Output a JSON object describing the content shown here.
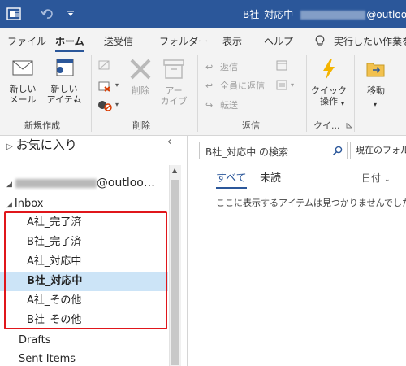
{
  "titlebar": {
    "app_icon": "outlook-app-icon",
    "undo_icon": "undo-icon",
    "qat_icon": "customize-quick-access-icon",
    "title_prefix": "B社_対応中 -",
    "title_suffix": "@outlook"
  },
  "tabs": [
    {
      "label": "ファイル"
    },
    {
      "label": "ホーム"
    },
    {
      "label": "送受信"
    },
    {
      "label": "フォルダー"
    },
    {
      "label": "表示"
    },
    {
      "label": "ヘルプ"
    },
    {
      "label": "実行したい作業を"
    }
  ],
  "ribbon": {
    "new_mail": "新しい\nメール",
    "new_items": "新しい\nアイテム",
    "delete": "削除",
    "archive": "アー\nカイブ",
    "reply": "返信",
    "reply_all": "全員に返信",
    "forward": "転送",
    "quick_steps": "クイック\n操作",
    "move": "移動",
    "groups": {
      "new": "新規作成",
      "delete": "削除",
      "respond": "返信",
      "quick": "クイ..."
    }
  },
  "leftpane": {
    "favorites": "お気に入り",
    "account_suffix": "@outloo…",
    "inbox": "Inbox",
    "folders": [
      {
        "label": "A社_完了済",
        "selected": false
      },
      {
        "label": "B社_完了済",
        "selected": false
      },
      {
        "label": "A社_対応中",
        "selected": false
      },
      {
        "label": "B社_対応中",
        "selected": true
      },
      {
        "label": "A社_その他",
        "selected": false
      },
      {
        "label": "B社_その他",
        "selected": false
      }
    ],
    "drafts": "Drafts",
    "sent": "Sent Items"
  },
  "rightpane": {
    "search_placeholder": "B社_対応中 の検索",
    "scope": "現在のフォルダー",
    "filter_all": "すべて",
    "filter_unread": "未読",
    "sort": "日付",
    "empty_message": "ここに表示するアイテムは見つかりませんでした。"
  },
  "colors": {
    "titlebar": "#2b579a",
    "accent": "#2b579a",
    "selection": "#cce4f7",
    "highlight_box": "#e0161b"
  }
}
